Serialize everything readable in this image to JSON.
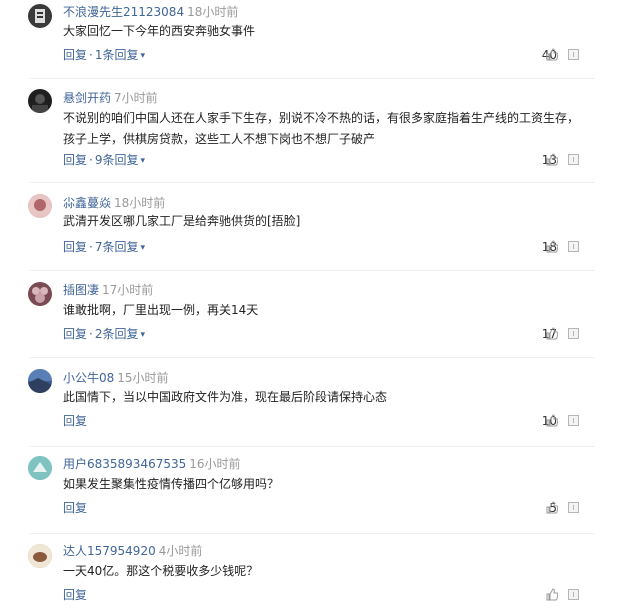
{
  "comments": [
    {
      "username": "不浪漫先生21123084",
      "time": "18小时前",
      "text": "大家回忆一下今年的西安奔驰女事件",
      "reply_label": "回复",
      "replies_label": "1条回复",
      "likes": "40",
      "avatar_color": "#3a3a3a"
    },
    {
      "username": "悬剑开药",
      "time": "7小时前",
      "text": "不说别的咱们中国人还在人家手下生存，别说不冷不热的话，有很多家庭指着生产线的工资生存，孩子上学，供棋房贷款，这些工人不想下岗也不想厂子破产",
      "reply_label": "回复",
      "replies_label": "9条回复",
      "likes": "13",
      "avatar_color": "#1f1f1f"
    },
    {
      "username": "尛鑫蔓焱",
      "time": "18小时前",
      "text": "武清开发区哪几家工厂是给奔驰供货的[捂脸]",
      "reply_label": "回复",
      "replies_label": "7条回复",
      "likes": "18",
      "avatar_color": "#b0666a"
    },
    {
      "username": "插图凄",
      "time": "17小时前",
      "text": "谁敢批啊，厂里出现一例，再关14天",
      "reply_label": "回复",
      "replies_label": "2条回复",
      "likes": "17",
      "avatar_color": "#7a4a52"
    },
    {
      "username": "小公牛08",
      "time": "15小时前",
      "text": "此国情下，当以中国政府文件为准，现在最后阶段请保持心态",
      "reply_label": "回复",
      "replies_label": "",
      "likes": "10",
      "avatar_color": "#3c5a8c"
    },
    {
      "username": "用户6835893467535",
      "time": "16小时前",
      "text": "如果发生聚集性疫情传播四个亿够用吗？",
      "reply_label": "回复",
      "replies_label": "",
      "likes": "5",
      "avatar_color": "#6fb3b3"
    },
    {
      "username": "达人157954920",
      "time": "4小时前",
      "text": "一天40亿。那这个税要收多少钱呢？",
      "reply_label": "回复",
      "replies_label": "",
      "likes": "",
      "avatar_color": "#c9b79c"
    }
  ],
  "icons": {
    "like": "thumbs-up-icon",
    "report": "report-icon"
  }
}
